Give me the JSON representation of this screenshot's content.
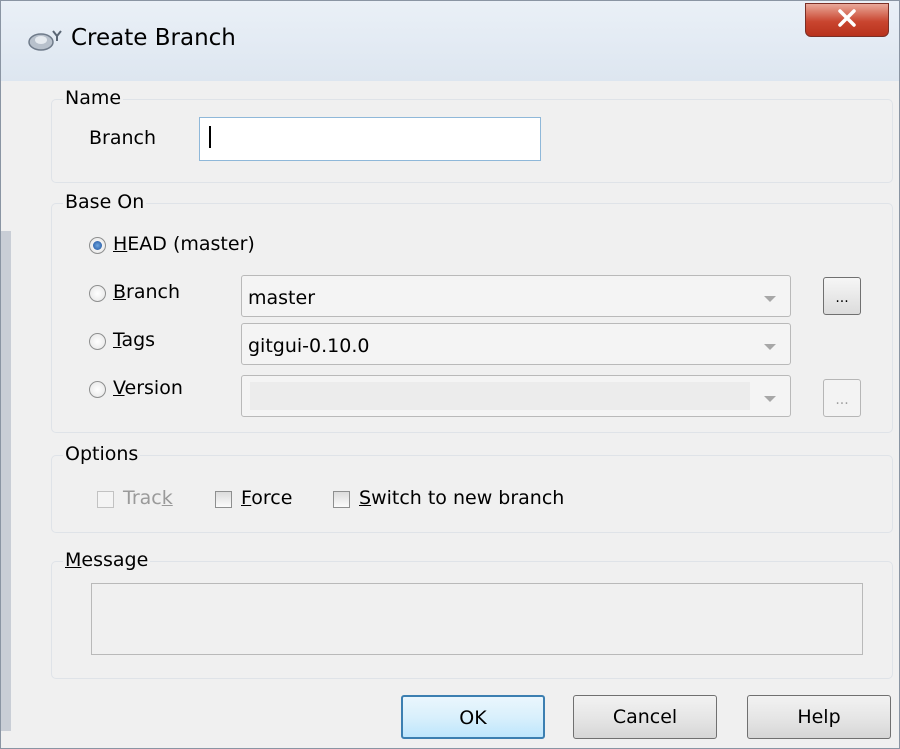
{
  "window": {
    "title": "Create Branch",
    "close_label": "X"
  },
  "name_group": {
    "label": "Name",
    "branch_label": "Branch",
    "branch_value": ""
  },
  "base_group": {
    "label": "Base On",
    "head": {
      "key": "H",
      "rest": "EAD (master)",
      "checked": true
    },
    "branch": {
      "key": "B",
      "rest": "ranch",
      "value": "master",
      "browse": "..."
    },
    "tags": {
      "key": "T",
      "rest": "ags",
      "value": "gitgui-0.10.0"
    },
    "version": {
      "key": "V",
      "rest": "ersion",
      "value": "",
      "browse": "..."
    }
  },
  "options_group": {
    "label": "Options",
    "track": {
      "pre": "Trac",
      "key": "k",
      "checked": false,
      "disabled": true
    },
    "force": {
      "key": "F",
      "rest": "orce",
      "checked": false
    },
    "switch": {
      "key": "S",
      "rest": "witch to new branch",
      "checked": false
    }
  },
  "message_group": {
    "key": "M",
    "rest": "essage",
    "value": ""
  },
  "buttons": {
    "ok": "OK",
    "cancel": "Cancel",
    "help": "Help"
  },
  "colors": {
    "accent": "#3c7fb1",
    "close": "#c9452f"
  }
}
